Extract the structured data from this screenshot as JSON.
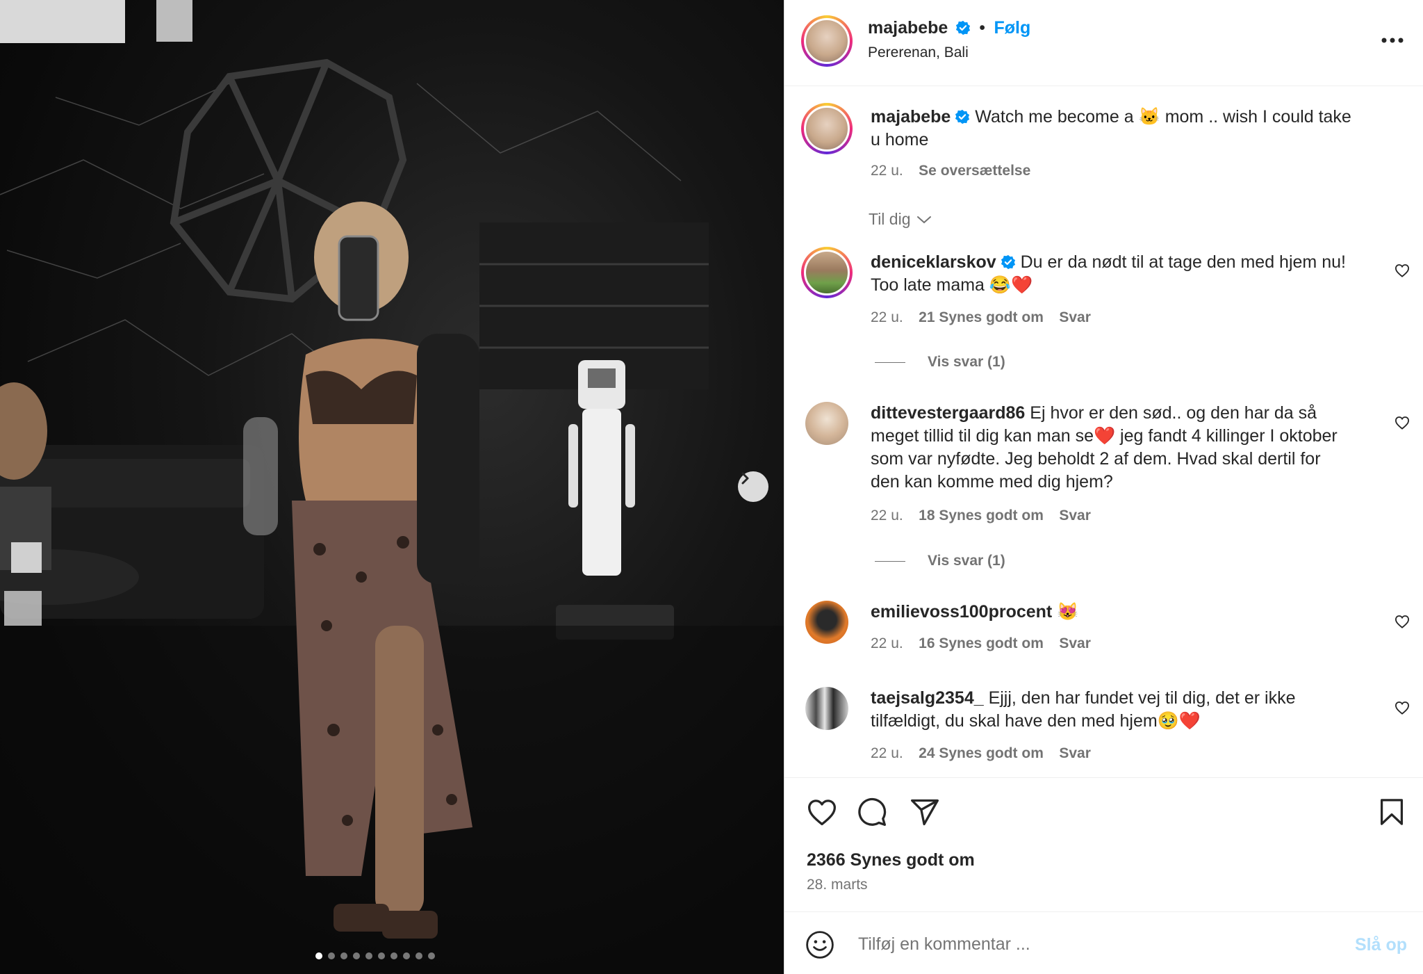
{
  "header": {
    "username": "majabebe",
    "follow_label": "Følg",
    "location": "Pererenan, Bali",
    "more_icon": "more-horizontal-icon"
  },
  "caption": {
    "username": "majabebe",
    "text_before": "Watch me become a",
    "emoji": "🐱",
    "text_after": "mom .. wish I could take",
    "text_line2": "u home",
    "time": "22 u.",
    "translate_label": "Se oversættelse"
  },
  "sort": {
    "label": "Til dig"
  },
  "comments": [
    {
      "username": "deniceklarskov",
      "verified": true,
      "line1": "Du er da nødt til at tage den med hjem nu!",
      "line2": "Too late mama 😂❤️",
      "time": "22 u.",
      "likes": "21 Synes godt om",
      "reply": "Svar",
      "view_replies": "Vis svar (1)"
    },
    {
      "username": "dittevestergaard86",
      "verified": false,
      "line1": "Ej hvor er den sød.. og den har da så",
      "line2": "meget tillid til dig kan man se❤️ jeg fandt 4 killinger I oktober",
      "line3": "som var nyfødte. Jeg beholdt 2 af dem. Hvad skal dertil for",
      "line4": "den kan komme med dig hjem?",
      "time": "22 u.",
      "likes": "18 Synes godt om",
      "reply": "Svar",
      "view_replies": "Vis svar (1)"
    },
    {
      "username": "emilievoss100procent",
      "verified": false,
      "line1": "😻",
      "time": "22 u.",
      "likes": "16 Synes godt om",
      "reply": "Svar"
    },
    {
      "username": "taejsalg2354_",
      "verified": false,
      "line1": "Ejjj, den har fundet vej til dig, det er ikke",
      "line2": "tilfældigt, du skal have den med hjem🥹❤️",
      "time": "22 u.",
      "likes": "24 Synes godt om",
      "reply": "Svar"
    }
  ],
  "post": {
    "likes": "2366 Synes godt om",
    "date": "28. marts"
  },
  "add_comment": {
    "placeholder": "Tilføj en kommentar ...",
    "post_label": "Slå op"
  },
  "carousel": {
    "total_slides": 10,
    "active_index": 0
  },
  "colors": {
    "accent": "#0095f6",
    "verified": "#0095f6",
    "text": "#262626",
    "muted": "#737373",
    "post_disabled": "#b2dffc"
  }
}
